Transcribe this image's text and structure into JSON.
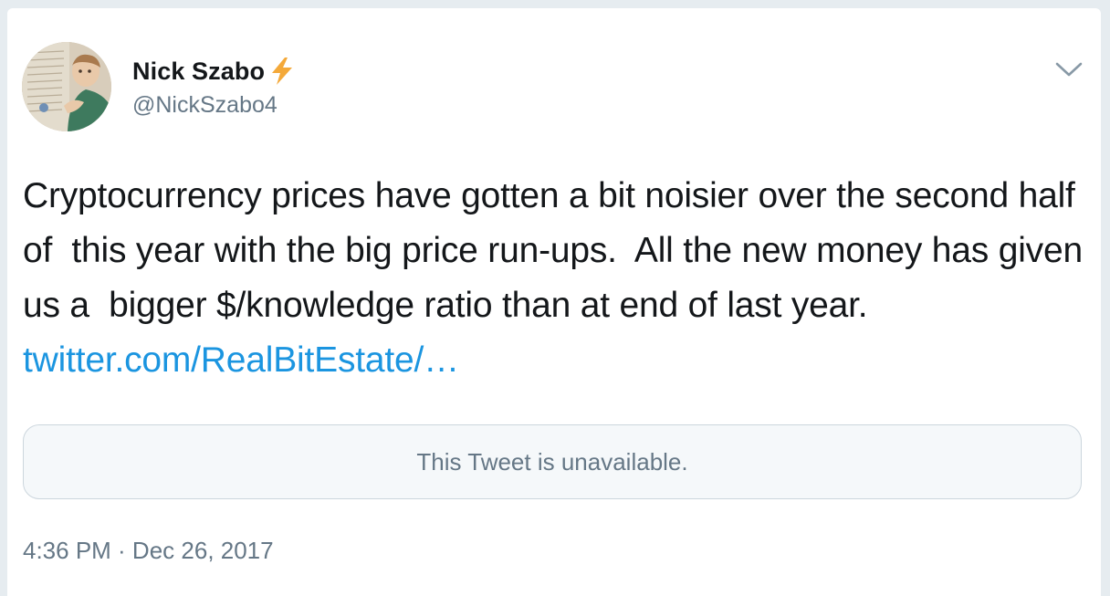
{
  "author": {
    "display_name": "Nick Szabo",
    "handle": "@NickSzabo4",
    "name_emoji_icon": "high-voltage-icon",
    "avatar_icon": "profile-photo"
  },
  "tweet": {
    "text": "Cryptocurrency prices have gotten a bit noisier over the second half of  this year with the big price run-ups.  All the new money has given us a  bigger $/knowledge ratio than at end of last year. ",
    "link_text": "twitter.com/RealBitEstate/…"
  },
  "quoted_tweet": {
    "message": "This Tweet is unavailable."
  },
  "meta": {
    "timestamp": "4:36 PM · Dec 26, 2017"
  },
  "menu": {
    "icon": "chevron-down-icon"
  },
  "colors": {
    "background": "#e6ecf0",
    "primary_text": "#14171a",
    "secondary_text": "#657786",
    "link": "#1b95e0",
    "bolt": "#f4a93a"
  }
}
